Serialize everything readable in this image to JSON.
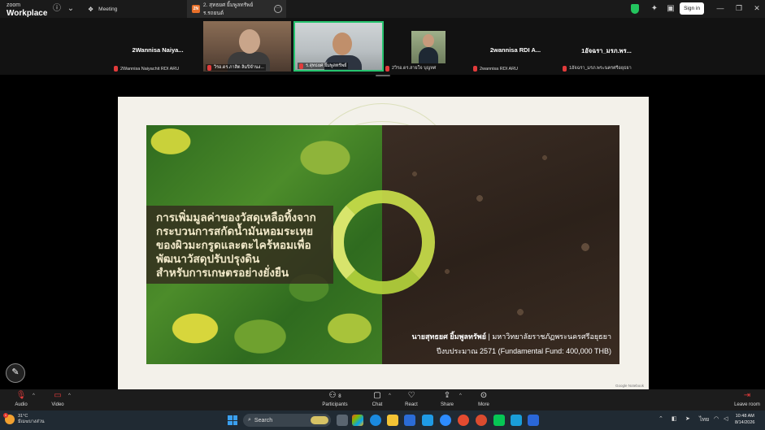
{
  "window": {
    "app_logo_line1": "zoom",
    "app_logo_line2": "Workplace",
    "tab_meeting": "Meeting",
    "tab_active_badge": "2N",
    "tab_active_title": "2. สุทธยศ ยิ้มพูลทรัพย์ ร.รถยนต์",
    "signin_label": "Sign in"
  },
  "participants": [
    {
      "display_name": "2Wannisa  Naiya...",
      "label": "2Wannisa Naiyachit RDI ARU"
    },
    {
      "label": "วิรอ.ดร.ภาสิต ลิมปิจำนง..."
    },
    {
      "label": "ร.สุทธยศ ยิ้มพูลทรัพย์"
    },
    {
      "label": "2วิรอ.ดร.สายใจ บุญทศ"
    },
    {
      "display_name": "2wannisa  RDI A...",
      "label": "2wannisa  RDI ARU"
    },
    {
      "display_name": "1อัจฉรา_มรภ.พร...",
      "label": "1อัจฉรา_มรภ.พระนครศรีอยุธยา"
    }
  ],
  "slide": {
    "title_lines": [
      "การเพิ่มมูลค่าของวัสดุเหลือทิ้งจาก",
      "กระบวนการสกัดน้ำมันหอมระเหย",
      "ของผิวมะกรูดและตะไคร้หอมเพื่อ",
      "พัฒนาวัสดุปรับปรุงดิน",
      "สำหรับการเกษตรอย่างยั่งยืน"
    ],
    "presenter_name": "นายสุทธยศ ยิ้มพูลทรัพย์",
    "presenter_affiliation": " | มหาวิทยาลัยราชภัฏพระนครศรีอยุธยา",
    "budget": "ปีงบประมาณ 2571 (Fundamental Fund: 400,000 THB)",
    "watermark": "Google Notebook"
  },
  "toolbar": {
    "audio": "Audio",
    "video": "Video",
    "participants": "Participants",
    "participants_count": "8",
    "chat": "Chat",
    "react": "React",
    "share": "Share",
    "more": "More",
    "leave": "Leave room"
  },
  "taskbar": {
    "weather_temp": "31°C",
    "weather_desc": "มีเมฆบางส่วน",
    "weather_badge": "1",
    "search_placeholder": "Search",
    "lang": "ไทย",
    "time": "10:48 AM",
    "date": "8/14/2026"
  },
  "colors": {
    "accent_green": "#27c46f",
    "mic_off_red": "#e23b3b",
    "leave_red": "#e23b3b",
    "ring_lime": "#c9de4a"
  }
}
